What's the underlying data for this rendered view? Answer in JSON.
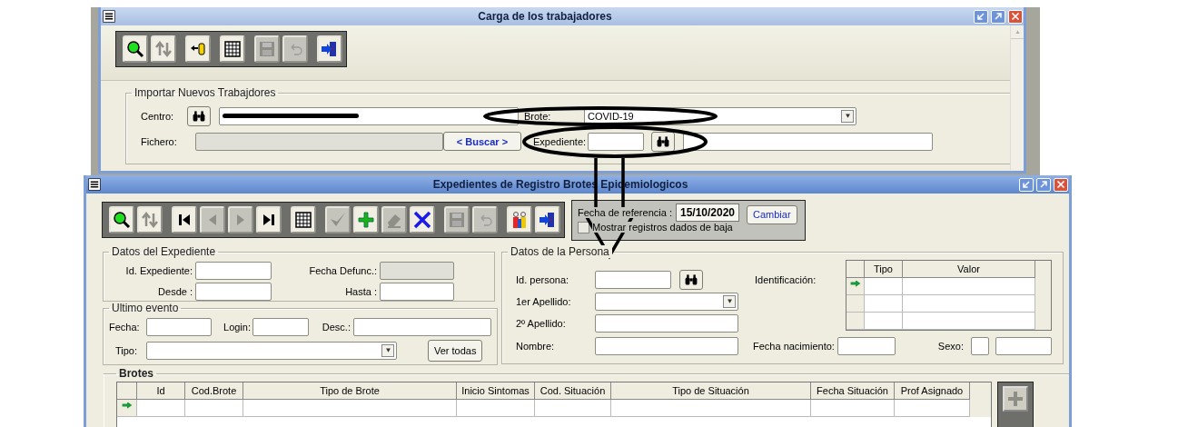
{
  "carga_window": {
    "title": "Carga de los trabajadores",
    "toolbar": [
      {
        "kind": "search",
        "disabled": false
      },
      {
        "kind": "sort",
        "disabled": false
      },
      {
        "kind": "import",
        "disabled": false
      },
      {
        "kind": "grid",
        "disabled": false
      },
      {
        "kind": "save",
        "disabled": true
      },
      {
        "kind": "undo",
        "disabled": true
      },
      {
        "kind": "exit",
        "disabled": false
      }
    ],
    "import_group": {
      "legend": "Importar Nuevos Trabajdores",
      "centro_label": "Centro:",
      "centro_redacted": true,
      "brote_label": "Brote:",
      "brote_value": "COVID-19",
      "fichero_label": "Fichero:",
      "buscar_button": "< Buscar >",
      "expediente_label": "Expediente:"
    }
  },
  "expedientes_window": {
    "title": "Expedientes de Registro Brotes Epidemiologicos",
    "toolbar": [
      {
        "kind": "search",
        "disabled": false
      },
      {
        "kind": "sort",
        "disabled": false
      },
      {
        "kind": "first",
        "disabled": false
      },
      {
        "kind": "prev",
        "disabled": true
      },
      {
        "kind": "next",
        "disabled": true
      },
      {
        "kind": "last",
        "disabled": false
      },
      {
        "kind": "grid",
        "disabled": false
      },
      {
        "kind": "check",
        "disabled": true
      },
      {
        "kind": "plus",
        "disabled": false
      },
      {
        "kind": "eraser",
        "disabled": true
      },
      {
        "kind": "delete",
        "disabled": false
      },
      {
        "kind": "save",
        "disabled": true
      },
      {
        "kind": "undo",
        "disabled": true
      },
      {
        "kind": "people",
        "disabled": false
      },
      {
        "kind": "exit",
        "disabled": false
      }
    ],
    "reference": {
      "label": "Fecha de referencia :",
      "date": "15/10/2020",
      "button": "Cambiar",
      "show_deleted": {
        "label": "Mostrar registros dados de baja",
        "checked": false
      }
    },
    "expediente_group": {
      "legend": "Datos del Expediente",
      "id_label": "Id. Expediente:",
      "defunc_label": "Fecha Defunc.:",
      "desde_label": "Desde :",
      "hasta_label": "Hasta :"
    },
    "evento_group": {
      "legend": "Ultimo evento",
      "fecha_label": "Fecha:",
      "login_label": "Login:",
      "desc_label": "Desc.:",
      "tipo_label": "Tipo:",
      "ver_button": "Ver todas"
    },
    "persona_group": {
      "legend": "Datos de la Persona",
      "id_label": "Id. persona:",
      "apellido1_label": "1er Apellido:",
      "apellido2_label": "2º Apellido:",
      "nombre_label": "Nombre:",
      "identificacion_label": "Identificación:",
      "nacimiento_label": "Fecha nacimiento:",
      "sexo_label": "Sexo:",
      "identificacion_table": {
        "columns": [
          "Tipo",
          "Valor"
        ],
        "rows": [
          {
            "current": true
          },
          {
            "current": false
          },
          {
            "current": false
          }
        ]
      }
    },
    "brotes": {
      "title": "Brotes",
      "columns": [
        "Id",
        "Cod.Brote",
        "Tipo de Brote",
        "Inicio Sintomas",
        "Cod. Situación",
        "Tipo de Situación",
        "Fecha Situación",
        "Prof Asignado"
      ],
      "rows": [
        {
          "current": true
        }
      ],
      "add_disabled": true
    }
  }
}
